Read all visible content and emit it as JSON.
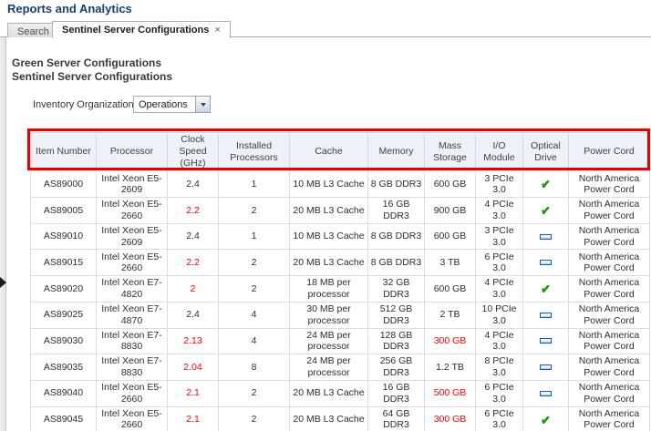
{
  "page": {
    "title": "Reports and Analytics"
  },
  "tabs": {
    "inactive_label": "Search",
    "active_label": "Sentinel Server Configurations",
    "close_glyph": "×"
  },
  "section": {
    "title1": "Green Server Configurations",
    "title2": "Sentinel Server Configurations"
  },
  "filter": {
    "label": "Inventory Organization",
    "selected_value": "Operations"
  },
  "colors": {
    "annotation_red": "#e80000",
    "alert_text_red": "#ff0000",
    "check_green": "#17a017",
    "dash_blue": "#1758b0",
    "title_blue": "#1a3c75"
  },
  "icons": {
    "optical_yes": "check-icon",
    "optical_no": "dash-icon",
    "check_glyph": "✔"
  },
  "table": {
    "columns": [
      "Item Number",
      "Processor",
      "Clock Speed (GHz)",
      "Installed Processors",
      "Cache",
      "Memory",
      "Mass Storage",
      "I/O Module",
      "Optical Drive",
      "Power Cord"
    ],
    "rows": [
      {
        "item": "AS89000",
        "processor": "Intel Xeon E5-2609",
        "clock": "2.4",
        "clock_red": false,
        "installed": "1",
        "cache": "10 MB L3 Cache",
        "memory": "8 GB DDR3",
        "storage": "600 GB",
        "storage_red": false,
        "io": "3 PCIe 3.0",
        "optical": "check",
        "power": "North America Power Cord"
      },
      {
        "item": "AS89005",
        "processor": "Intel Xeon E5-2660",
        "clock": "2.2",
        "clock_red": true,
        "installed": "2",
        "cache": "20 MB L3 Cache",
        "memory": "16 GB DDR3",
        "storage": "900 GB",
        "storage_red": false,
        "io": "4 PCIe 3.0",
        "optical": "check",
        "power": "North America Power Cord"
      },
      {
        "item": "AS89010",
        "processor": "Intel Xeon E5-2609",
        "clock": "2.4",
        "clock_red": false,
        "installed": "1",
        "cache": "10 MB L3 Cache",
        "memory": "8 GB DDR3",
        "storage": "600 GB",
        "storage_red": false,
        "io": "3 PCIe 3.0",
        "optical": "dash",
        "power": "North America Power Cord"
      },
      {
        "item": "AS89015",
        "processor": "Intel Xeon E5-2660",
        "clock": "2.2",
        "clock_red": true,
        "installed": "2",
        "cache": "20 MB L3 Cache",
        "memory": "8 GB DDR3",
        "storage": "3 TB",
        "storage_red": false,
        "io": "6 PCIe 3.0",
        "optical": "dash",
        "power": "North America Power Cord"
      },
      {
        "item": "AS89020",
        "processor": "Intel Xeon E7-4820",
        "clock": "2",
        "clock_red": true,
        "installed": "2",
        "cache": "18 MB per processor",
        "memory": "32 GB DDR3",
        "storage": "600 GB",
        "storage_red": false,
        "io": "4 PCIe 3.0",
        "optical": "check",
        "power": "North America Power Cord"
      },
      {
        "item": "AS89025",
        "processor": "Intel Xeon E7-4870",
        "clock": "2.4",
        "clock_red": false,
        "installed": "4",
        "cache": "30 MB per processor",
        "memory": "512 GB DDR3",
        "storage": "2 TB",
        "storage_red": false,
        "io": "10 PCIe 3.0",
        "optical": "dash",
        "power": "North America Power Cord"
      },
      {
        "item": "AS89030",
        "processor": "Intel Xeon E7-8830",
        "clock": "2.13",
        "clock_red": true,
        "installed": "4",
        "cache": "24 MB per processor",
        "memory": "128 GB DDR3",
        "storage": "300 GB",
        "storage_red": true,
        "io": "4 PCIe 3.0",
        "optical": "dash",
        "power": "North America Power Cord"
      },
      {
        "item": "AS89035",
        "processor": "Intel Xeon E7-8830",
        "clock": "2.04",
        "clock_red": true,
        "installed": "8",
        "cache": "24 MB per processor",
        "memory": "256 GB DDR3",
        "storage": "1.2 TB",
        "storage_red": false,
        "io": "8 PCIe 3.0",
        "optical": "dash",
        "power": "North America Power Cord"
      },
      {
        "item": "AS89040",
        "processor": "Intel Xeon E5-2660",
        "clock": "2.1",
        "clock_red": true,
        "installed": "2",
        "cache": "20 MB L3 Cache",
        "memory": "16 GB DDR3",
        "storage": "500 GB",
        "storage_red": true,
        "io": "6 PCIe 3.0",
        "optical": "dash",
        "power": "North America Power Cord"
      },
      {
        "item": "AS89045",
        "processor": "Intel Xeon E5-2660",
        "clock": "2.1",
        "clock_red": true,
        "installed": "2",
        "cache": "20 MB L3 Cache",
        "memory": "64 GB DDR3",
        "storage": "300 GB",
        "storage_red": true,
        "io": "6 PCIe 3.0",
        "optical": "check",
        "power": "North America Power Cord"
      }
    ]
  }
}
